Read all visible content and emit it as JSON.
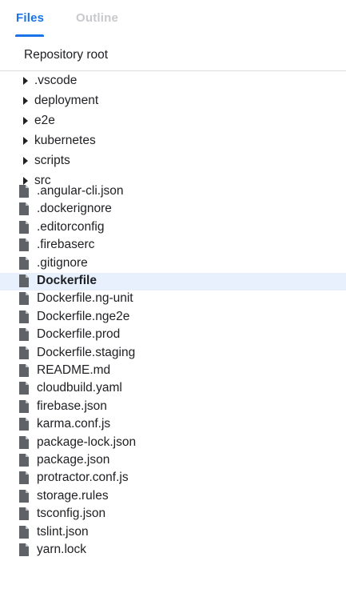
{
  "tabs": [
    {
      "label": "Files",
      "active": true
    },
    {
      "label": "Outline",
      "active": false
    }
  ],
  "colors": {
    "accent": "#1a73e8",
    "selected_bg": "#e8f0fe",
    "inactive_tab": "#c8c9cc"
  },
  "tree": {
    "root_label": "Repository root",
    "folders": [
      ".vscode",
      "deployment",
      "e2e",
      "kubernetes",
      "scripts",
      "src"
    ],
    "files": [
      ".angular-cli.json",
      ".dockerignore",
      ".editorconfig",
      ".firebaserc",
      ".gitignore",
      "Dockerfile",
      "Dockerfile.ng-unit",
      "Dockerfile.nge2e",
      "Dockerfile.prod",
      "Dockerfile.staging",
      "README.md",
      "cloudbuild.yaml",
      "firebase.json",
      "karma.conf.js",
      "package-lock.json",
      "package.json",
      "protractor.conf.js",
      "storage.rules",
      "tsconfig.json",
      "tslint.json",
      "yarn.lock"
    ],
    "selected_file": "Dockerfile",
    "folder_icon": "caret-right-icon",
    "file_icon": "file-icon"
  }
}
